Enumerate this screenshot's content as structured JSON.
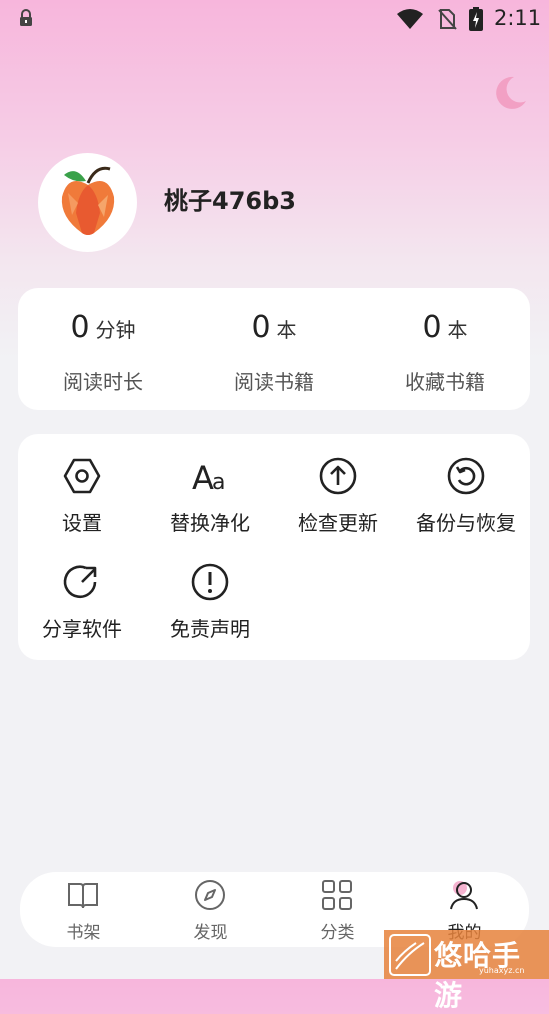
{
  "status_bar": {
    "time": "2:11"
  },
  "profile": {
    "username": "桃子476b3"
  },
  "stats": [
    {
      "value": "0",
      "unit": "分钟",
      "label": "阅读时长"
    },
    {
      "value": "0",
      "unit": "本",
      "label": "阅读书籍"
    },
    {
      "value": "0",
      "unit": "本",
      "label": "收藏书籍"
    }
  ],
  "menu": [
    {
      "label": "设置",
      "icon": "hexagon-settings-icon"
    },
    {
      "label": "替换净化",
      "icon": "text-aa-icon"
    },
    {
      "label": "检查更新",
      "icon": "arrow-up-circle-icon"
    },
    {
      "label": "备份与恢复",
      "icon": "restore-circle-icon"
    },
    {
      "label": "分享软件",
      "icon": "share-arrow-icon"
    },
    {
      "label": "免责声明",
      "icon": "exclamation-circle-icon"
    }
  ],
  "tabs": [
    {
      "label": "书架",
      "icon": "book-icon"
    },
    {
      "label": "发现",
      "icon": "compass-icon"
    },
    {
      "label": "分类",
      "icon": "grid-icon"
    },
    {
      "label": "我的",
      "icon": "person-icon",
      "active": true
    }
  ],
  "watermark": {
    "text": "悠哈手游",
    "url": "yuhaxyz.cn"
  },
  "colors": {
    "accent_pink": "#f2a0c4",
    "background": "#f2f2f5"
  }
}
